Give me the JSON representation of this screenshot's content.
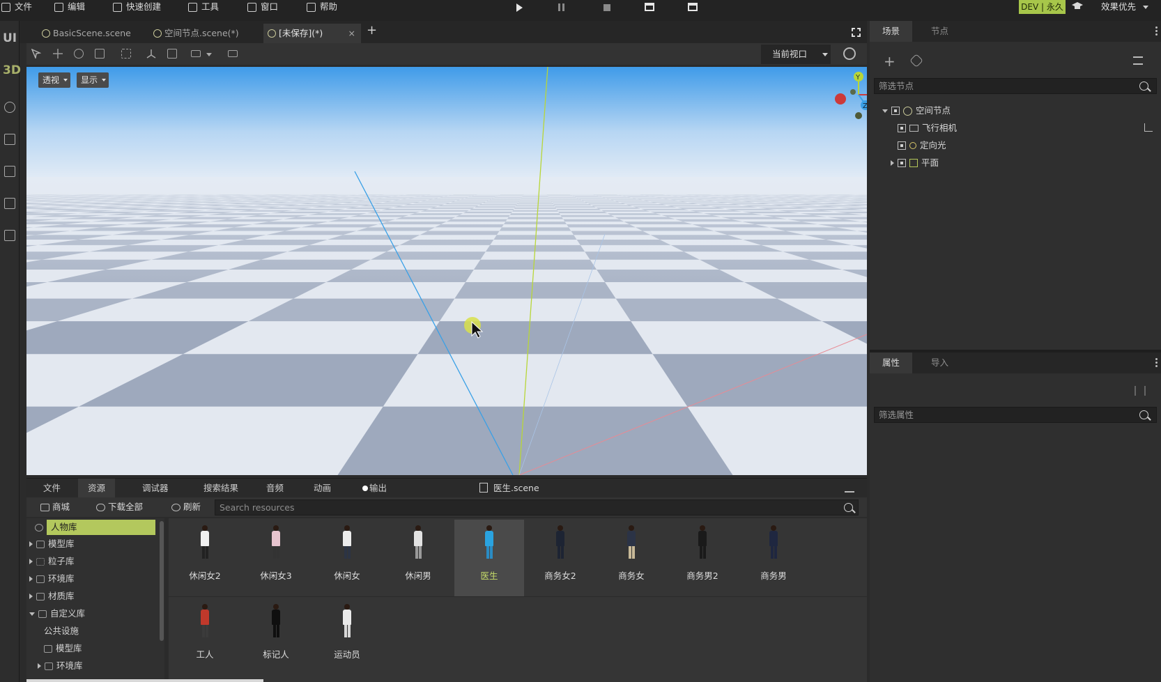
{
  "menu": {
    "items": [
      "文件",
      "编辑",
      "快速创建",
      "工具",
      "窗口",
      "帮助"
    ],
    "dev_badge": "DEV | 永久",
    "quality": "效果优先"
  },
  "left_strip": {
    "ui_label": "UI",
    "three_d_label": "3D"
  },
  "tabs": [
    {
      "label": "BasicScene.scene"
    },
    {
      "label": "空间节点.scene(*)"
    },
    {
      "label": "[未保存](*)",
      "active": true
    }
  ],
  "toolbar": {
    "viewport_select": "当前视口"
  },
  "viewport": {
    "projection_button": "透视",
    "display_button": "显示",
    "gizmo": {
      "y": "Y",
      "z": "Z"
    }
  },
  "bottom": {
    "tabs": [
      "文件",
      "资源",
      "调试器",
      "搜索结果",
      "音频",
      "动画",
      "输出"
    ],
    "active_tab": "资源",
    "scene_file": "医生.scene",
    "store_button": "商城",
    "download_all_button": "下载全部",
    "refresh_button": "刷新",
    "search_placeholder": "Search resources"
  },
  "library_tree": [
    {
      "label": "人物库",
      "selected": true
    },
    {
      "label": "模型库"
    },
    {
      "label": "粒子库"
    },
    {
      "label": "环境库"
    },
    {
      "label": "材质库"
    },
    {
      "label": "自定义库",
      "expanded": true
    },
    {
      "label": "公共设施"
    },
    {
      "label": "模型库"
    },
    {
      "label": "环境库"
    }
  ],
  "resources": [
    {
      "label": "休闲女2",
      "top": "#f0f0f0",
      "legs": "#222"
    },
    {
      "label": "休闲女3",
      "top": "#e7c4cf",
      "legs": "#333"
    },
    {
      "label": "休闲女",
      "top": "#ececec",
      "legs": "#2c3444"
    },
    {
      "label": "休闲男",
      "top": "#e2e2e2",
      "legs": "#9a9a9a"
    },
    {
      "label": "医生",
      "top": "#2aa3e0",
      "legs": "#2a8cc4",
      "selected": true
    },
    {
      "label": "商务女2",
      "top": "#1d2433",
      "legs": "#1d2433"
    },
    {
      "label": "商务女",
      "top": "#2b3346",
      "legs": "#c8b998"
    },
    {
      "label": "商务男2",
      "top": "#1a1a1a",
      "legs": "#1a1a1a"
    },
    {
      "label": "商务男",
      "top": "#1f2740",
      "legs": "#1f2740"
    },
    {
      "label": "工人",
      "top": "#c0392b",
      "legs": "#3b3b3b"
    },
    {
      "label": "标记人",
      "top": "#0f0f0f",
      "legs": "#0f0f0f"
    },
    {
      "label": "运动员",
      "top": "#eaeaea",
      "legs": "#d8d8d8"
    }
  ],
  "scene_panel": {
    "tabs": [
      "场景",
      "节点"
    ],
    "filter_placeholder": "筛选节点",
    "nodes": [
      {
        "label": "空间节点"
      },
      {
        "label": "飞行相机"
      },
      {
        "label": "定向光"
      },
      {
        "label": "平面"
      }
    ]
  },
  "property_panel": {
    "tabs": [
      "属性",
      "导入"
    ],
    "filter_placeholder": "筛选属性"
  },
  "colors": {
    "accent": "#b3c85d",
    "dev_badge": "#a7c64a",
    "sky_top": "#3f9be9",
    "axis_y": "#b8d638",
    "axis_z": "#3aa0e6",
    "axis_x": "#e0474a"
  }
}
